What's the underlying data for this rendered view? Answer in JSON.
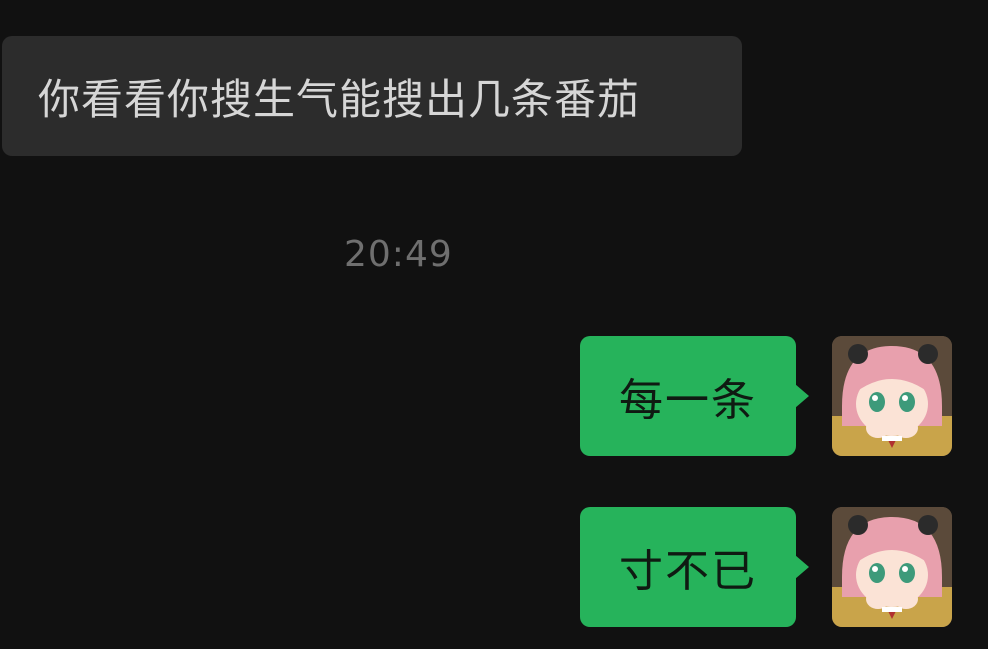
{
  "messages": {
    "incoming": [
      {
        "text": "你看看你搜生气能搜出几条番茄"
      }
    ],
    "timestamp": "20:49",
    "outgoing": [
      {
        "text": "每一条",
        "avatar_icon": "anime-girl-avatar-icon"
      },
      {
        "text": "寸不已",
        "avatar_icon": "anime-girl-avatar-icon"
      }
    ]
  },
  "colors": {
    "background": "#111111",
    "incoming_bubble": "#2c2c2c",
    "outgoing_bubble": "#26b35b",
    "timestamp": "#6f6f6f"
  }
}
